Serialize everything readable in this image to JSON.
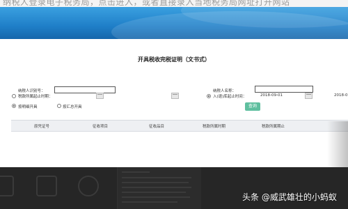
{
  "top_caption": "纳税人登录电子税务局，点击进入，或者直接录入当地税务局网址打开网站",
  "page_title": "开具税收完税证明（文书式）",
  "form": {
    "taxpayer_id_label": "纳税人识别号：",
    "tax_period_label": "税款所属起止时期：",
    "taxpayer_name_label": "纳税人名称：",
    "collection_time_label": "入(退)库起止时间：",
    "date_start": "2018-09-01",
    "date_end": "2018-0",
    "radio_by_detail": "按明细开具",
    "radio_by_summary": "按汇总开具",
    "query_button": "查询"
  },
  "table": {
    "headers": [
      "原凭证号",
      "征收项目",
      "征收品目",
      "税款所属时期",
      "税款所属期止"
    ]
  },
  "watermark": "头条 @威武雄壮的小蚂蚁"
}
